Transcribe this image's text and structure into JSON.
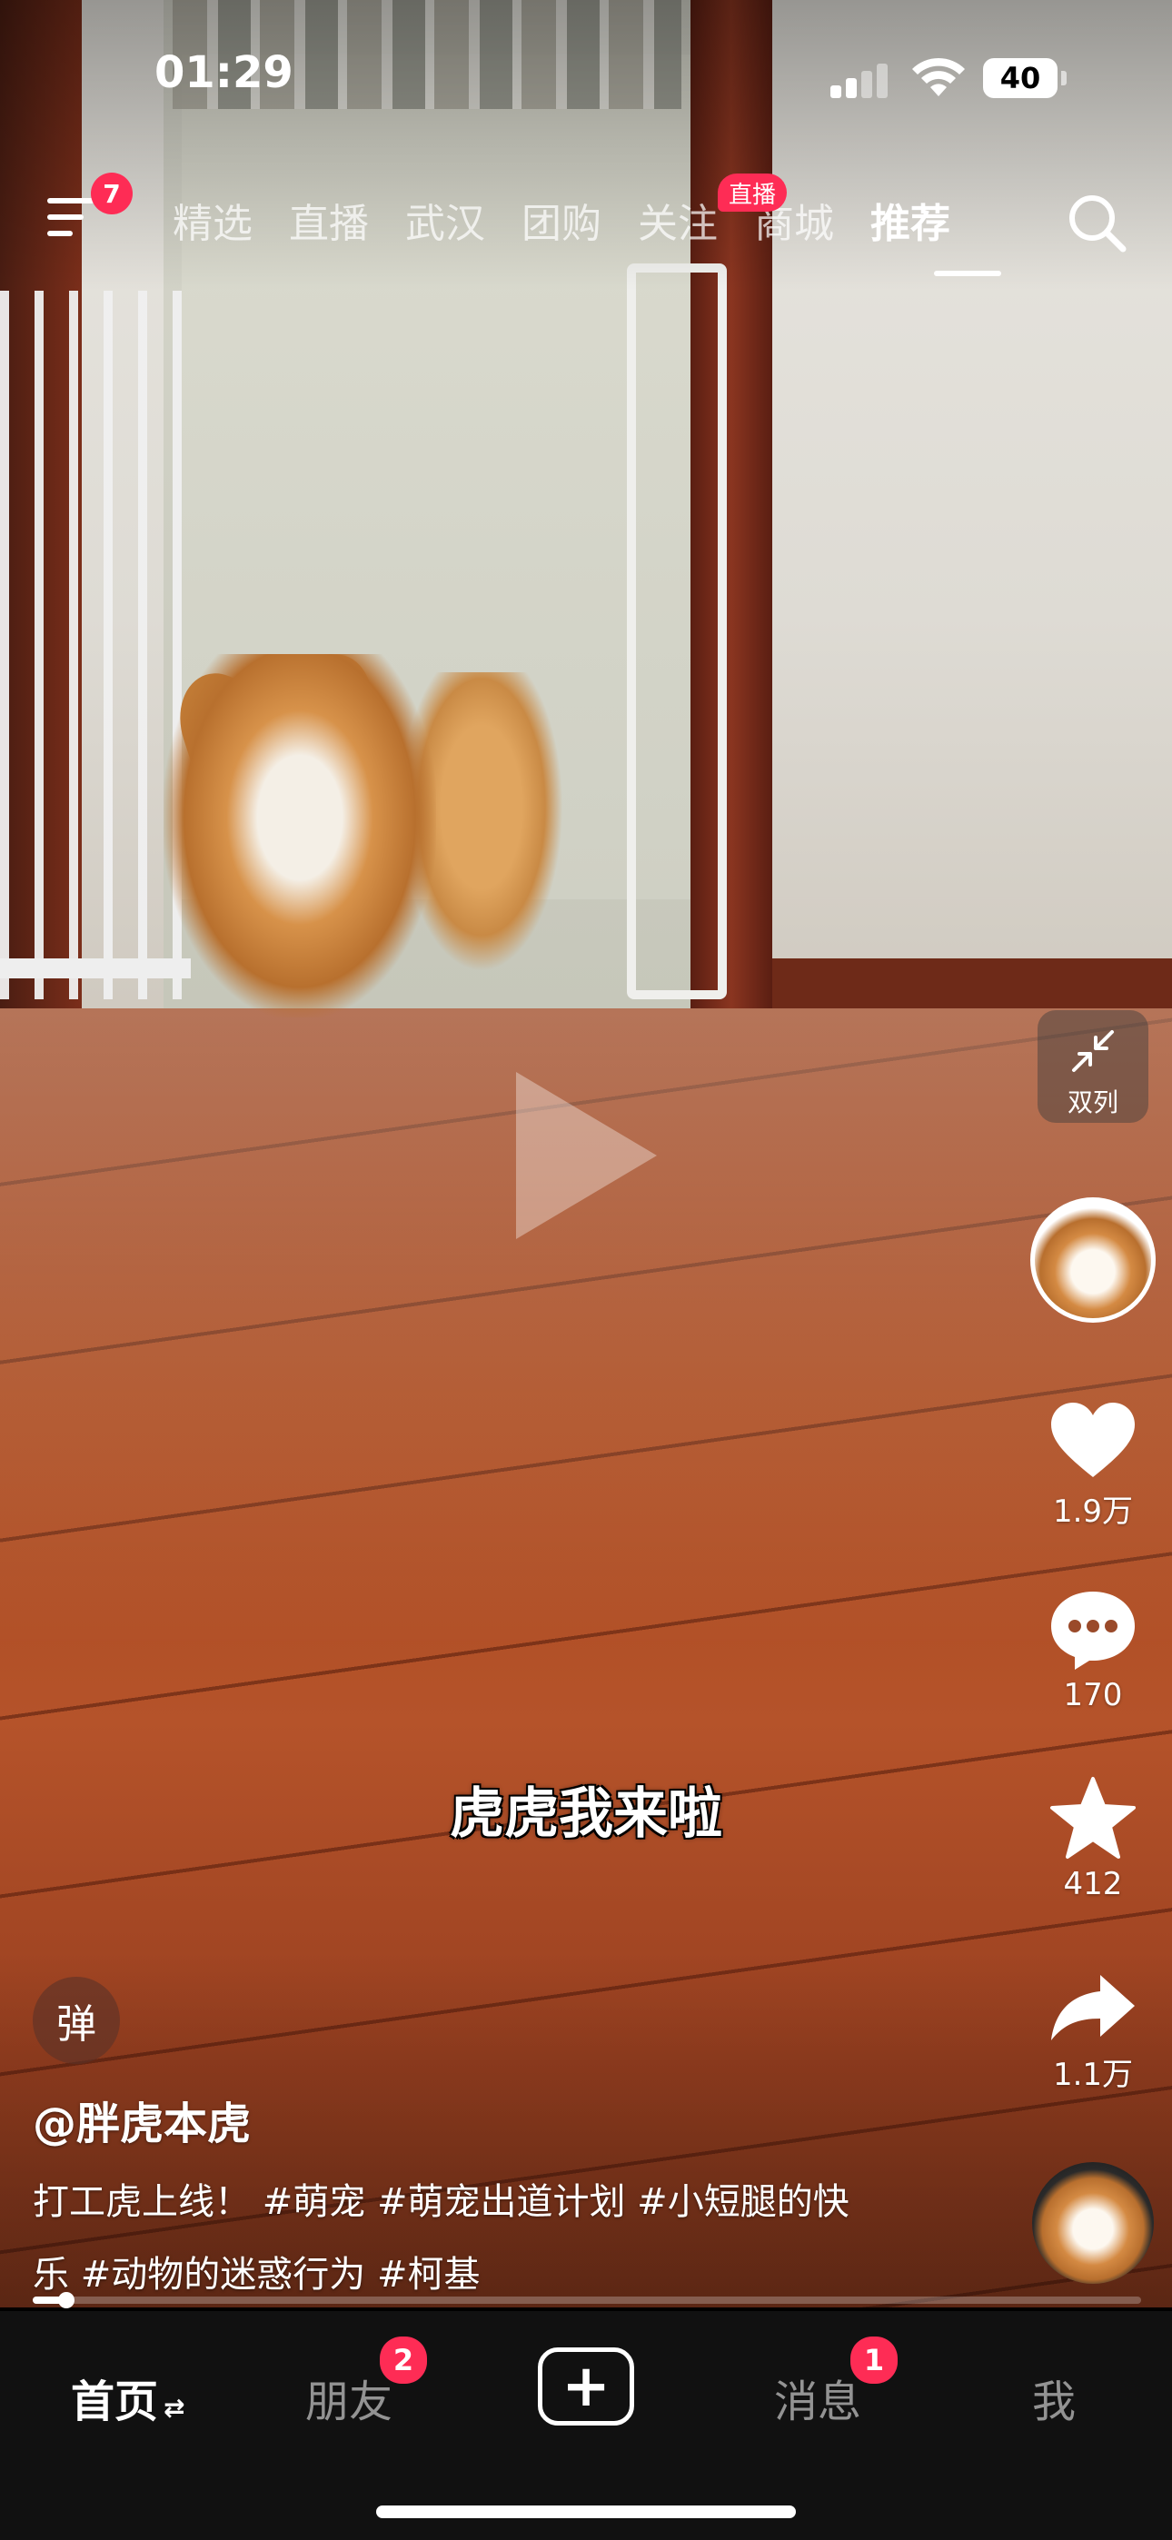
{
  "status_bar": {
    "time": "01:29",
    "battery": "40"
  },
  "top_nav": {
    "menu_badge": "7",
    "tabs": [
      {
        "label": "精选"
      },
      {
        "label": "直播"
      },
      {
        "label": "武汉"
      },
      {
        "label": "团购"
      },
      {
        "label": "关注"
      },
      {
        "label": "商城"
      },
      {
        "label": "推荐"
      }
    ],
    "active_tab": "推荐",
    "follow_live_badge": "直播"
  },
  "right_rail": {
    "dual_column_label": "双列",
    "likes": "1.9万",
    "comments": "170",
    "favorites": "412",
    "shares": "1.1万"
  },
  "video": {
    "subtitle": "虎虎我来啦",
    "danmaku_label": "弹",
    "author": "@胖虎本虎",
    "description_line1": "打工虎上线！ #萌宠 #萌宠出道计划 #小短腿的快",
    "description_line2": "乐 #动物的迷惑行为 #柯基",
    "progress": 0.03
  },
  "tab_bar": {
    "home": "首页",
    "friends": "朋友",
    "friends_badge": "2",
    "create": "+",
    "messages": "消息",
    "messages_badge": "1",
    "me": "我"
  },
  "colors": {
    "accent": "#fe2c55",
    "tabbar_bg": "#111111"
  }
}
